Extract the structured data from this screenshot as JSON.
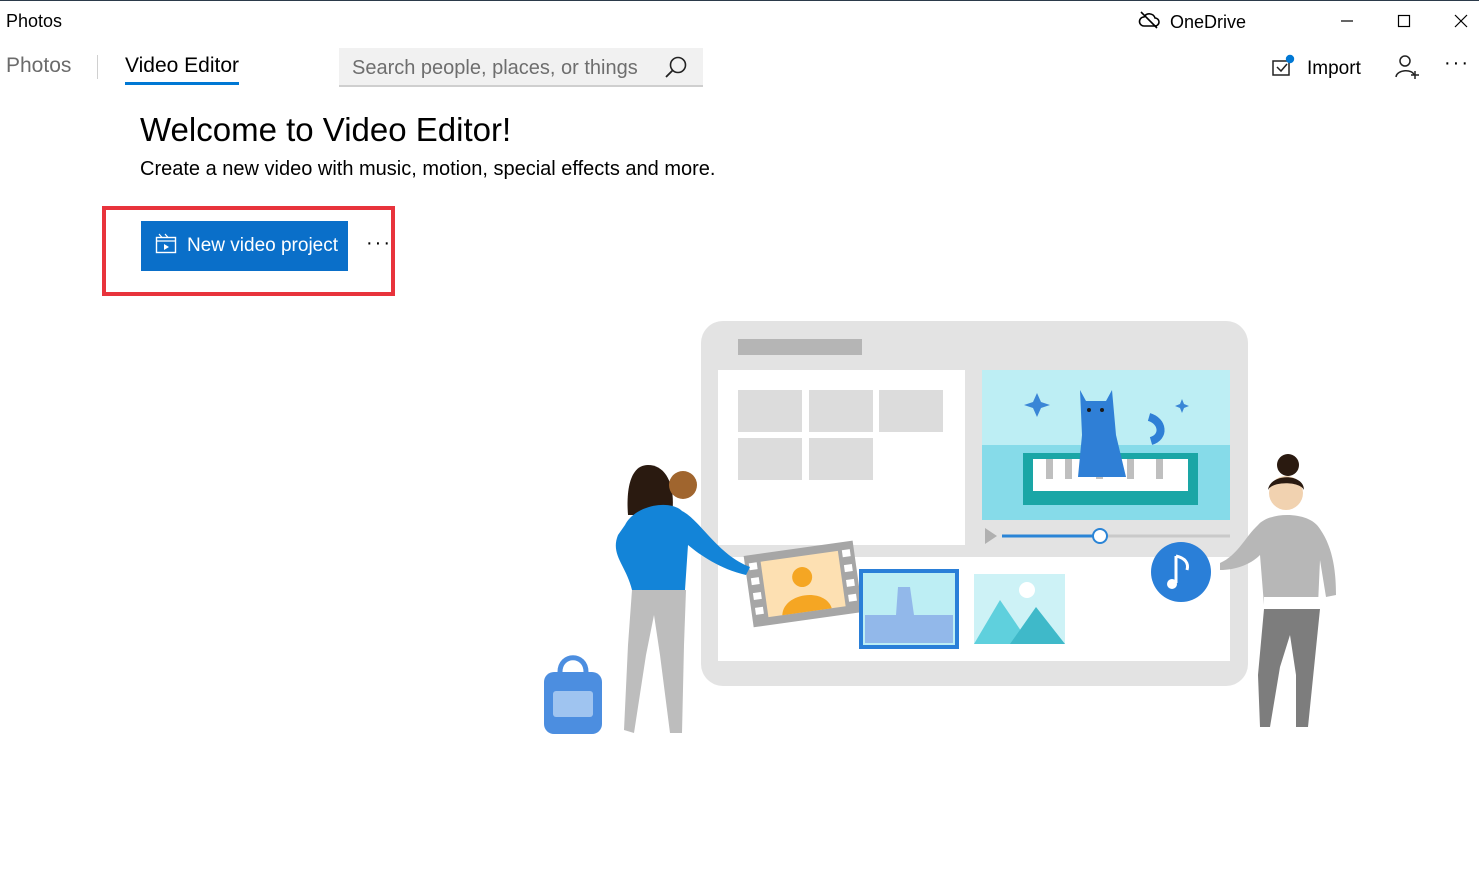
{
  "window": {
    "title": "Photos",
    "onedrive_label": "OneDrive"
  },
  "nav": {
    "tabs": [
      {
        "label": "Photos",
        "selected": false
      },
      {
        "label": "Video Editor",
        "selected": true
      }
    ],
    "search_placeholder": "Search people, places, or things",
    "import_label": "Import",
    "more_label": "···"
  },
  "main": {
    "heading": "Welcome to Video Editor!",
    "subtitle": "Create a new video with music, motion, special effects and more.",
    "new_project_label": "New video project",
    "more_label": "···"
  },
  "colors": {
    "accent": "#0078d4",
    "button": "#0a6fc9",
    "highlight_box": "#e8333c"
  }
}
